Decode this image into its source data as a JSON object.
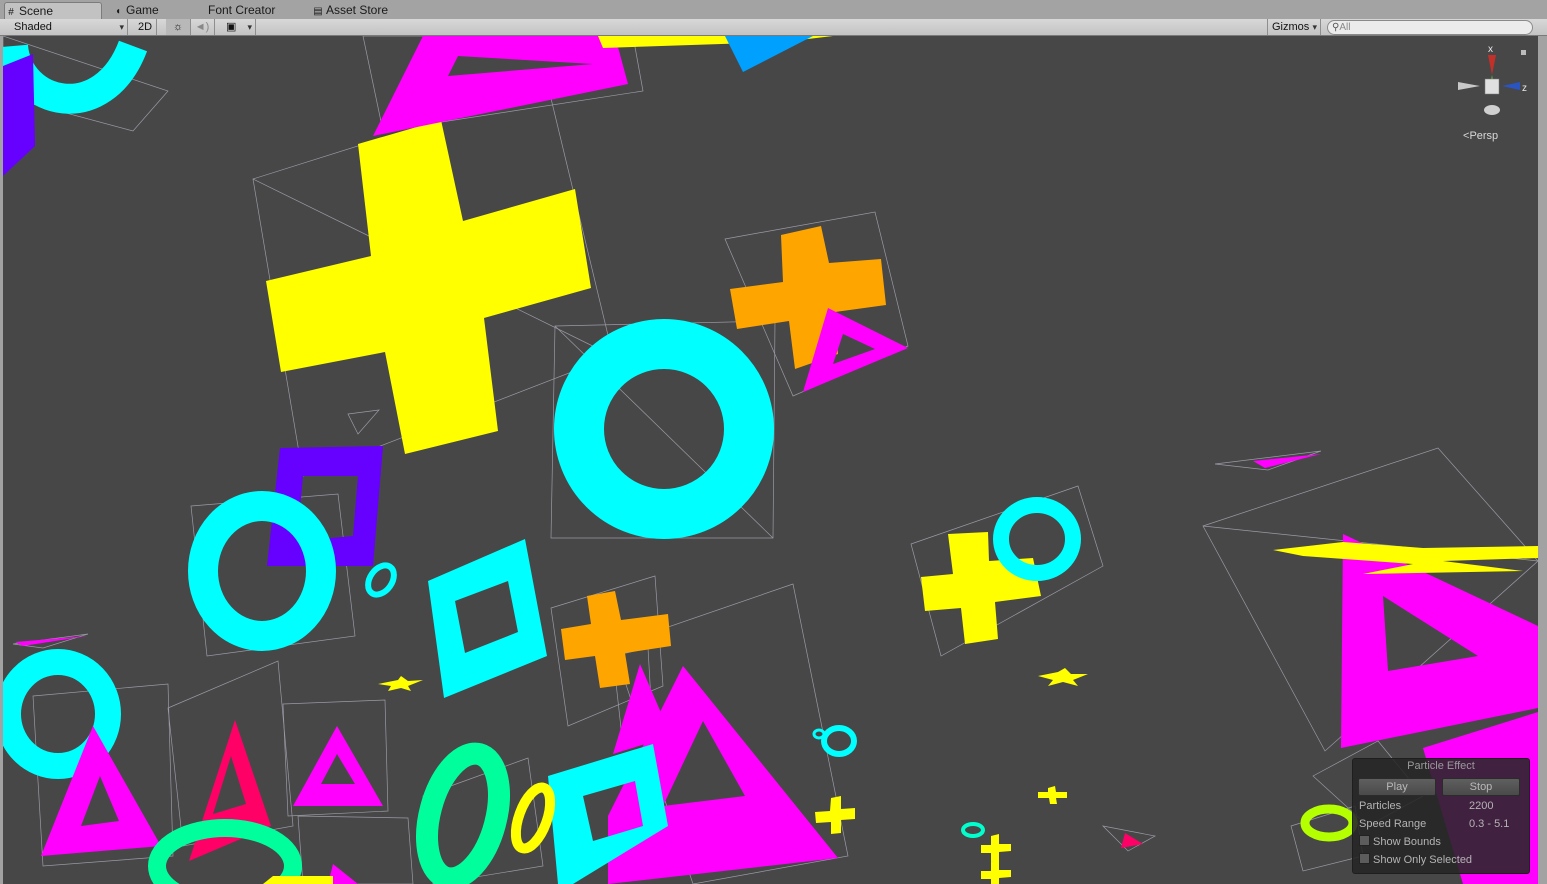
{
  "tabs": [
    {
      "label": "Scene",
      "icon": "grid-icon"
    },
    {
      "label": "Game",
      "icon": "pacman-icon"
    },
    {
      "label": "Font Creator",
      "icon": ""
    },
    {
      "label": "Asset Store",
      "icon": "store-icon"
    }
  ],
  "toolbar": {
    "draw_mode": "Shaded",
    "mode_2d": "2D",
    "gizmos_label": "Gizmos",
    "search_placeholder": "All",
    "icons": [
      "sun-icon",
      "speaker-icon",
      "image-icon"
    ]
  },
  "scene_gizmo": {
    "x_label": "x",
    "z_label": "z",
    "projection": "Persp"
  },
  "particle_effect": {
    "title": "Particle Effect",
    "play_label": "Play",
    "stop_label": "Stop",
    "particles_label": "Particles",
    "particles_value": "2200",
    "speed_range_label": "Speed Range",
    "speed_range_value": "0.3 - 5.1",
    "show_bounds_label": "Show Bounds",
    "show_only_selected_label": "Show Only Selected"
  },
  "colors": {
    "viewport_bg": "#474747",
    "yellow": "#ffff00",
    "cyan": "#00ffff",
    "magenta": "#ff00ff",
    "orange": "#ffa500",
    "purple": "#6600ff",
    "blue": "#00a0ff",
    "green": "#00ff9c",
    "lime": "#b4ff00",
    "pink": "#ff0066"
  }
}
